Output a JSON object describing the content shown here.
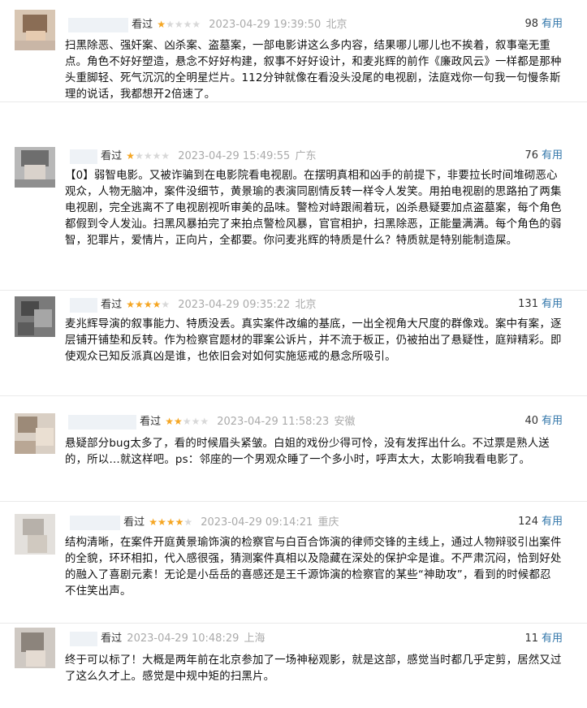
{
  "watched_label": "看过",
  "useful_label": "有用",
  "comments": [
    {
      "stars": "★☆☆☆☆",
      "time": "2023-04-29 19:39:50",
      "location": "北京",
      "votes": "98",
      "text": "扫黑除恶、强奸案、凶杀案、盗墓案，一部电影讲这么多内容，结果哪儿哪儿也不挨着，叙事毫无重点。角色不好好塑造，悬念不好好构建，叙事不好好设计，和麦兆辉的前作《廉政风云》一样都是那种头重脚轻、死气沉沉的全明星烂片。112分钟就像在看没头没尾的电视剧，法庭戏你一句我一句慢条斯理的说话，我都想开2倍速了。"
    },
    {
      "stars": "★☆☆☆☆",
      "time": "2023-04-29 15:49:55",
      "location": "广东",
      "votes": "76",
      "text": "【0】弱智电影。又被诈骗到在电影院看电视剧。在摆明真相和凶手的前提下，非要拉长时间堆砌恶心观众，人物无脑冲，案件没细节，黄景瑜的表演同剧情反转一样令人发笑。用拍电视剧的思路拍了两集电视剧，完全逃离不了电视剧视听审美的品味。警检对峙跟闹着玩，凶杀悬疑要加点盗墓案，每个角色都假到令人发汕。扫黑风暴拍完了来拍点警检风暴，官官相护，扫黑除恶，正能量满满。每个角色的弱智，犯罪片，爱情片，正向片，全都要。你问麦兆辉的特质是什么？特质就是特别能制造屎。"
    },
    {
      "stars": "★★★★☆",
      "time": "2023-04-29 09:35:22",
      "location": "北京",
      "votes": "131",
      "text": "麦兆辉导演的叙事能力、特质没丢。真实案件改编的基底，一出全视角大尺度的群像戏。案中有案，逐层铺开铺垫和反转。作为检察官题材的罪案公诉片，并不流于板正，仍被拍出了悬疑性，庭辩精彩。即使观众已知反派真凶是谁，也依旧会对如何实施惩戒的悬念所吸引。"
    },
    {
      "stars": "★★☆☆☆",
      "time": "2023-04-29 11:58:23",
      "location": "安徽",
      "votes": "40",
      "text": "悬疑部分bug太多了，看的时候眉头紧皱。白姐的戏份少得可怜，没有发挥出什么。不过票是熟人送的，所以…就这样吧。ps：邻座的一个男观众睡了一个多小时，呼声太大，太影响我看电影了。"
    },
    {
      "stars": "★★★★☆",
      "time": "2023-04-29 09:14:21",
      "location": "重庆",
      "votes": "124",
      "text": "结构清晰，在案件开庭黄景瑜饰演的检察官与白百合饰演的律师交锋的主线上，通过人物辩驳引出案件的全貌，环环相扣，代入感很强，猜测案件真相以及隐藏在深处的保护伞是谁。不严肃沉闷，恰到好处的融入了喜剧元素！无论是小岳岳的喜感还是王千源饰演的检察官的某些“神助攻”，看到的时候都忍不住笑出声。"
    },
    {
      "stars": "",
      "time": "2023-04-29 10:48:29",
      "location": "上海",
      "votes": "11",
      "text": "终于可以标了！大概是两年前在北京参加了一场神秘观影，就是这部，感觉当时都几乎定剪，居然又过了这么久才上。感觉是中规中矩的扫黑片。"
    }
  ]
}
